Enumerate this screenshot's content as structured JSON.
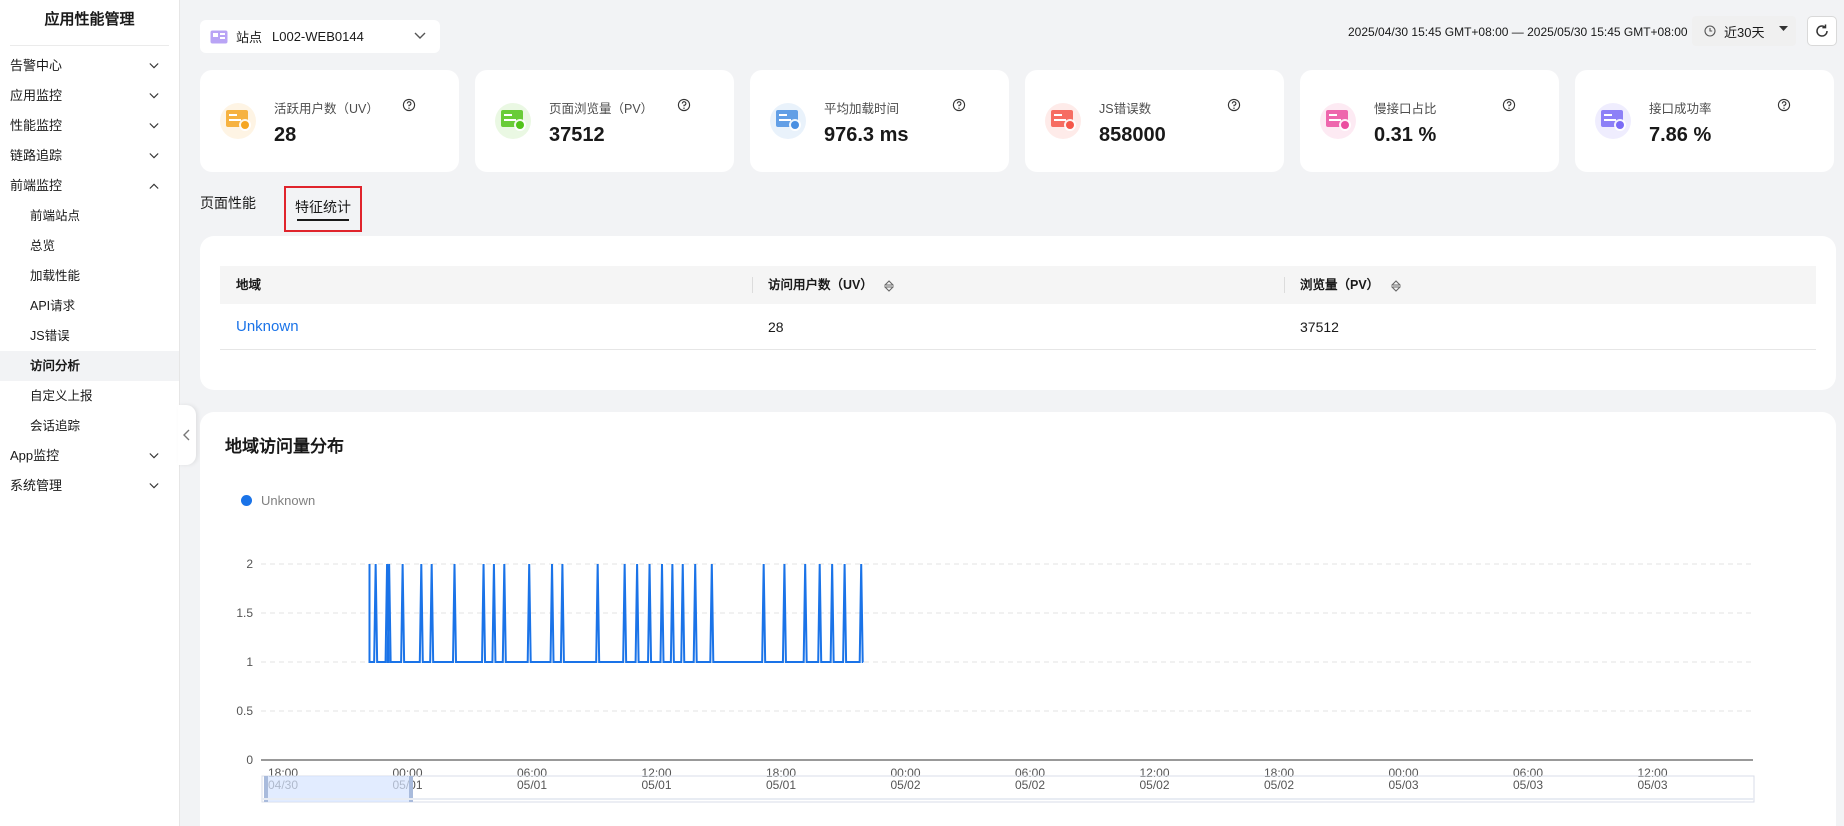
{
  "sidebar": {
    "title": "应用性能管理",
    "items": [
      {
        "label": "告警中心",
        "expanded": false
      },
      {
        "label": "应用监控",
        "expanded": false
      },
      {
        "label": "性能监控",
        "expanded": false
      },
      {
        "label": "链路追踪",
        "expanded": false
      },
      {
        "label": "前端监控",
        "expanded": true
      }
    ],
    "subitems": [
      "前端站点",
      "总览",
      "加载性能",
      "API请求",
      "JS错误",
      "访问分析",
      "自定义上报",
      "会话追踪"
    ],
    "active_sub": "访问分析",
    "items_after": [
      {
        "label": "App监控",
        "expanded": false
      },
      {
        "label": "系统管理",
        "expanded": false
      }
    ]
  },
  "topbar": {
    "site_label": "站点",
    "site_value": "L002-WEB0144",
    "time_range": "2025/04/30 15:45 GMT+08:00 — 2025/05/30 15:45 GMT+08:00",
    "range_label": "近30天"
  },
  "cards": [
    {
      "label": "活跃用户数（UV）",
      "value": "28",
      "icon": "user-icon",
      "color": "#f5a623"
    },
    {
      "label": "页面浏览量（PV）",
      "value": "37512",
      "icon": "page-view-icon",
      "color": "#52c41a"
    },
    {
      "label": "平均加载时间",
      "value": "976.3 ms",
      "icon": "load-time-icon",
      "color": "#4a90e2"
    },
    {
      "label": "JS错误数",
      "value": "858000",
      "icon": "js-error-icon",
      "color": "#f5574a"
    },
    {
      "label": "慢接口占比",
      "value": "0.31 %",
      "icon": "slow-api-icon",
      "color": "#eb4fa0"
    },
    {
      "label": "接口成功率",
      "value": "7.86 %",
      "icon": "api-success-icon",
      "color": "#7b6cf6"
    }
  ],
  "tabs": [
    {
      "label": "页面性能",
      "active": false
    },
    {
      "label": "特征统计",
      "active": true
    }
  ],
  "table": {
    "columns": [
      "地域",
      "访问用户数（UV）",
      "浏览量（PV）"
    ],
    "rows": [
      {
        "region": "Unknown",
        "uv": "28",
        "pv": "37512"
      }
    ]
  },
  "chart_data": {
    "type": "line",
    "title": "地域访问量分布",
    "legend": [
      "Unknown"
    ],
    "legend_position": "top-left",
    "ylim": [
      0,
      2
    ],
    "y_ticks": [
      "0",
      "0.5",
      "1",
      "1.5",
      "2"
    ],
    "grid": true,
    "x_ticks": [
      {
        "time": "18:00",
        "date": "04/30"
      },
      {
        "time": "00:00",
        "date": "05/01"
      },
      {
        "time": "06:00",
        "date": "05/01"
      },
      {
        "time": "12:00",
        "date": "05/01"
      },
      {
        "time": "18:00",
        "date": "05/01"
      },
      {
        "time": "00:00",
        "date": "05/02"
      },
      {
        "time": "06:00",
        "date": "05/02"
      },
      {
        "time": "12:00",
        "date": "05/02"
      },
      {
        "time": "18:00",
        "date": "05/02"
      },
      {
        "time": "00:00",
        "date": "05/03"
      },
      {
        "time": "06:00",
        "date": "05/03"
      },
      {
        "time": "12:00",
        "date": "05/03"
      }
    ],
    "series": [
      {
        "name": "Unknown",
        "color": "#1a73e8",
        "baseline": 1,
        "start_hours": 0,
        "end_hours": 23.6,
        "spikes_hours": [
          0.2,
          0.75,
          0.85,
          1.5,
          2.4,
          2.9,
          4.0,
          5.4,
          5.9,
          6.4,
          7.6,
          8.7,
          9.2,
          10.9,
          12.2,
          12.8,
          13.4,
          14.0,
          14.5,
          15.0,
          15.6,
          16.4,
          18.9,
          19.9,
          20.9,
          21.6,
          22.2,
          22.8,
          23.6
        ],
        "spike_value": 2
      }
    ]
  }
}
